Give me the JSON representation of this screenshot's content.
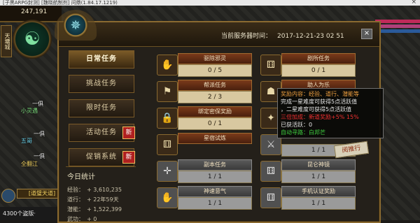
{
  "window": {
    "title": "[子黑ARPG封测] [魏晓航制剂] 问鼎(1.84.17.1219)",
    "close": "×"
  },
  "hud": {
    "score": "247,191",
    "city_plate": "天墉城",
    "map_labels": [
      "一俱",
      "小灵遇",
      "一俱",
      "五哥",
      "一俱",
      "全翻江"
    ],
    "legend_text": "[道璧天道]",
    "bottom_text": "4300个盗版·"
  },
  "panel": {
    "server_time_label": "当前服务器时间：",
    "server_time_value": "2017-12-21-23 02 51",
    "close_label": "×"
  },
  "nav": {
    "items": [
      {
        "label": "日常任务",
        "active": true,
        "new": false
      },
      {
        "label": "挑战任务",
        "active": false,
        "new": false
      },
      {
        "label": "限时任务",
        "active": false,
        "new": false
      },
      {
        "label": "活动任务",
        "active": false,
        "new": true
      },
      {
        "label": "促销系统",
        "active": false,
        "new": true
      }
    ],
    "new_badge": "新"
  },
  "stats": {
    "heading": "今日统计",
    "rows": [
      {
        "label": "经验：",
        "value": "+ 3,610,235"
      },
      {
        "label": "道行：",
        "value": "+ 22年59天"
      },
      {
        "label": "潜能：",
        "value": "+ 1,522,399"
      },
      {
        "label": "武功：",
        "value": "+ 0"
      }
    ]
  },
  "tasks": [
    {
      "name": "驱除邪灵",
      "progress": "0 / 5",
      "icon": "hand-icon",
      "glyph": "✋",
      "gray": false
    },
    {
      "name": "剧所任务",
      "progress": "0 / 1",
      "icon": "dice-icon",
      "glyph": "⚅",
      "gray": false
    },
    {
      "name": "帮派任务",
      "progress": "2 / 3",
      "icon": "banner-icon",
      "glyph": "⚑",
      "gray": false
    },
    {
      "name": "助人为乐",
      "progress": "",
      "icon": "helm-icon",
      "glyph": "☗",
      "gray": false
    },
    {
      "name": "绑定密保奖励",
      "progress": "0 / 1",
      "icon": "lock-icon",
      "glyph": "🔒",
      "gray": false
    },
    {
      "name": "",
      "progress": "",
      "icon": "swirl-icon",
      "glyph": "✦",
      "gray": false
    },
    {
      "name": "星宿试炼",
      "progress": "",
      "icon": "dice-icon",
      "glyph": "⚅",
      "gray": false
    },
    {
      "name": "",
      "progress": "1 / 1",
      "icon": "armor-icon",
      "glyph": "⚔",
      "gray": true
    },
    {
      "name": "副本任务",
      "progress": "1 / 1",
      "icon": "cross-icon",
      "glyph": "✛",
      "gray": true
    },
    {
      "name": "昆仑神镜",
      "progress": "1 / 1",
      "icon": "dice-icon",
      "glyph": "⚅",
      "gray": true
    },
    {
      "name": "神速意气",
      "progress": "1 / 1",
      "icon": "hand-icon",
      "glyph": "✋",
      "gray": true
    },
    {
      "name": "手机认证奖励",
      "progress": "1 / 1",
      "icon": "dice-icon",
      "glyph": "⚅",
      "gray": true
    }
  ],
  "tooltip": {
    "line1": "奖励内容：经验、道行、潜能等",
    "line2": "完成一星难度可获得5点活跃值",
    "line3": "，二星难度可获得5点活跃值",
    "line4": "三倍加成：新道奖励+5% 15%",
    "line5": "已获活跃：0",
    "line6": "自动寻路：白邦芒"
  },
  "pathing_button": "阅推行"
}
